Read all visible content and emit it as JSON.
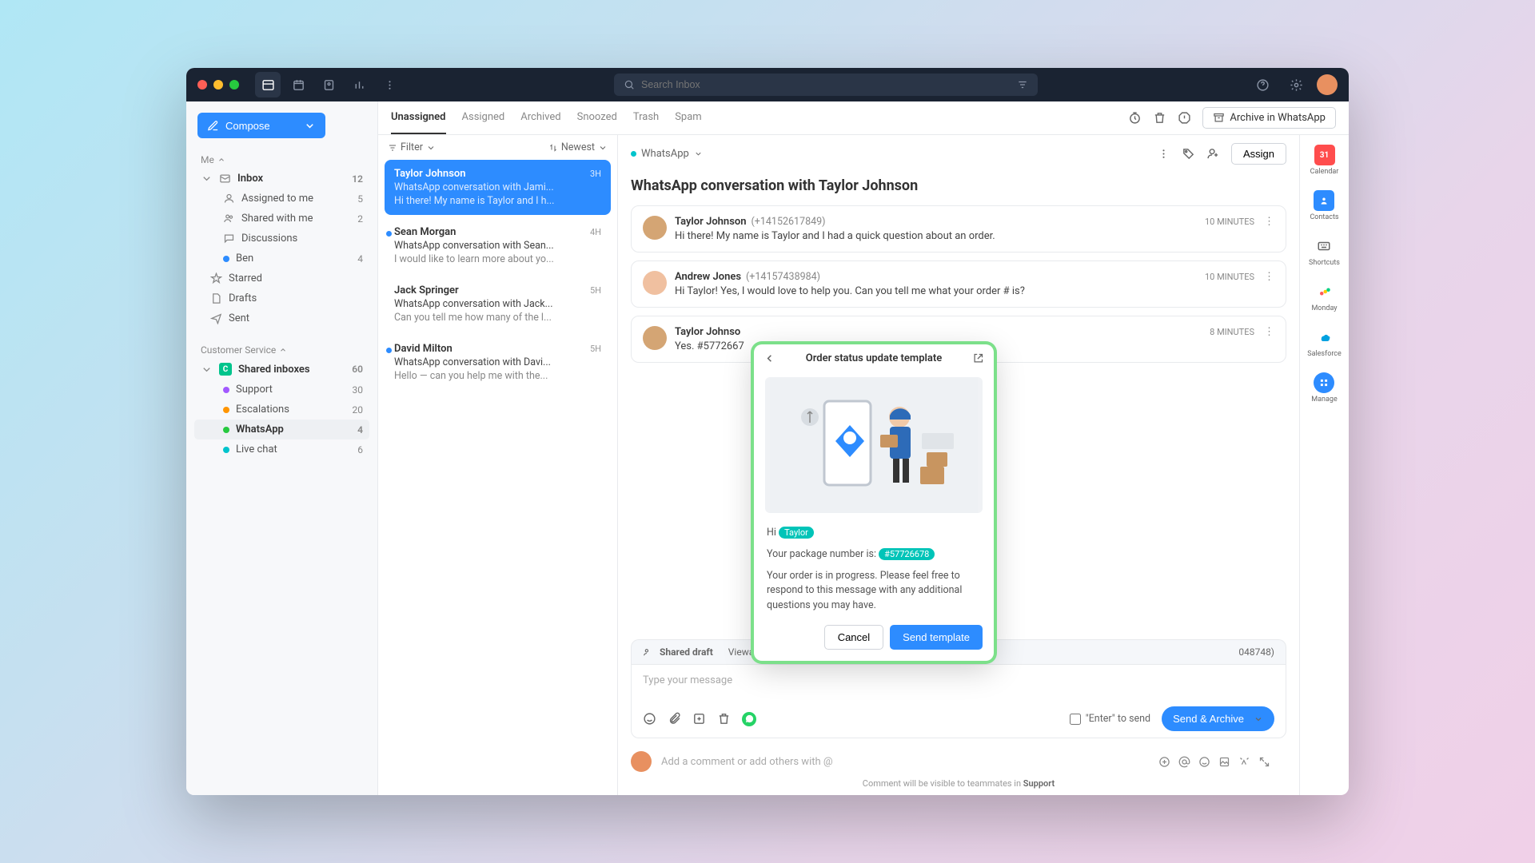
{
  "titlebar": {
    "search_placeholder": "Search Inbox"
  },
  "sidebar": {
    "compose": "Compose",
    "me": "Me",
    "items": [
      {
        "label": "Inbox",
        "count": "12"
      },
      {
        "label": "Assigned to me",
        "count": "5"
      },
      {
        "label": "Shared with me",
        "count": "2"
      },
      {
        "label": "Discussions",
        "count": ""
      },
      {
        "label": "Ben",
        "count": "4"
      },
      {
        "label": "Starred",
        "count": ""
      },
      {
        "label": "Drafts",
        "count": ""
      },
      {
        "label": "Sent",
        "count": ""
      }
    ],
    "cs_head": "Customer Service",
    "shared": {
      "label": "Shared inboxes",
      "count": "60"
    },
    "cs": [
      {
        "label": "Support",
        "count": "30"
      },
      {
        "label": "Escalations",
        "count": "20"
      },
      {
        "label": "WhatsApp",
        "count": "4"
      },
      {
        "label": "Live chat",
        "count": "6"
      }
    ]
  },
  "tabs": [
    "Unassigned",
    "Assigned",
    "Archived",
    "Snoozed",
    "Trash",
    "Spam"
  ],
  "archive_btn": "Archive in WhatsApp",
  "convlist": {
    "filter": "Filter",
    "sort": "Newest",
    "items": [
      {
        "name": "Taylor Johnson",
        "time": "3H",
        "sub": "WhatsApp conversation with Jami...",
        "prev": "Hi there! My name is Taylor and I h..."
      },
      {
        "name": "Sean Morgan",
        "time": "4H",
        "sub": "WhatsApp conversation with Sean...",
        "prev": "I would like to learn more about yo..."
      },
      {
        "name": "Jack Springer",
        "time": "5H",
        "sub": "WhatsApp conversation with Jack...",
        "prev": "Can you tell me how many of the l..."
      },
      {
        "name": "David Milton",
        "time": "5H",
        "sub": "WhatsApp conversation with Davi...",
        "prev": "Hello — can you help me with the..."
      }
    ]
  },
  "detail": {
    "channel": "WhatsApp",
    "assign": "Assign",
    "title": "WhatsApp conversation with Taylor Johnson",
    "msgs": [
      {
        "name": "Taylor Johnson",
        "phone": "(+14152617849)",
        "time": "10 MINUTES",
        "text": "Hi there! My name is Taylor and I had a quick question about an order."
      },
      {
        "name": "Andrew Jones",
        "phone": "(+14157438984)",
        "time": "10 MINUTES",
        "text": "Hi Taylor! Yes, I would love to help you. Can you tell me what your order # is?"
      },
      {
        "name": "Taylor Johnso",
        "phone": "",
        "time": "8 MINUTES",
        "text": "Yes. #5772667"
      }
    ],
    "draft": "Shared draft",
    "viewa": "Viewa",
    "draft_num": "048748)",
    "compose_ph": "Type your message",
    "enter": "\"Enter\" to send",
    "send": "Send & Archive",
    "comment_ph": "Add a comment or add others with @",
    "note1": "Comment will be visible to teammates in ",
    "note2": "Support"
  },
  "rsb": [
    "Calendar",
    "Contacts",
    "Shortcuts",
    "Monday",
    "Salesforce",
    "Manage"
  ],
  "popup": {
    "title": "Order status update template",
    "hi": "Hi",
    "name": "Taylor",
    "l1": "Your package number is:",
    "pkg": "#57726678",
    "l2": "Your order is in progress. Please feel free to respond to this message with any additional questions you may have.",
    "cancel": "Cancel",
    "send": "Send template"
  }
}
